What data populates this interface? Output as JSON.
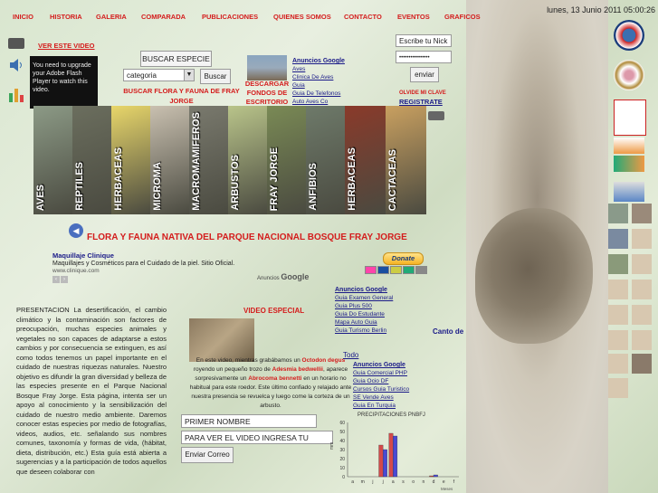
{
  "nav": [
    "INICIO",
    "HISTORIA",
    "GALERIA",
    "COMPARADA",
    "PUBLICACIONES",
    "QUIENES SOMOS",
    "CONTACTO",
    "EVENTOS",
    "GRAFICOS"
  ],
  "date": "lunes, 13 Junio 2011 05:00:26",
  "video_link": "VER ESTE VIDEO",
  "flash_msg": "You need to upgrade your Adobe Flash Player to watch this video.",
  "search": {
    "button_label": "BUSCAR ESPECIE",
    "category_value": "categoria",
    "buscar": "Buscar",
    "link": "BUSCAR FLORA Y FAUNA DE FRAY JORGE"
  },
  "descargar": "DESCARGAR FONDOS DE ESCRITORIO",
  "ads_top": {
    "header": "Anuncios Google",
    "items": [
      "Aves",
      "Clinica De Aves",
      "Guia",
      "Guia De Telefonos",
      "Auto Aves Co"
    ]
  },
  "login": {
    "nick_value": "Escribe tu Nick",
    "password_value": "••••••••••••••••",
    "submit": "enviar",
    "forgot": "OLVIDE MI CLAVE",
    "register": "REGISTRATE"
  },
  "strip_labels": [
    "AVES",
    "REPTILES",
    "HERBACEAS",
    "MICROMA",
    "MACROMAMIFEROS",
    "ARBUSTOS",
    "FRAY JORGE",
    "ANFIBIOS",
    "HERBACEAS",
    "CACTACEAS"
  ],
  "strip_colors": [
    "#8c9a86",
    "#6b6e5e",
    "#e8d66a",
    "#c9c0b0",
    "#7a7a6e",
    "#b9c48a",
    "#7a8a55",
    "#6e7a6a",
    "#8a3a2a",
    "#c9a060"
  ],
  "main_title": "FLORA Y FAUNA NATIVA DEL PARQUE NACIONAL BOSQUE FRAY JORGE",
  "ad_banner": {
    "title": "Maquillaje Clinique",
    "text": "Maquillajes y Cosméticos para el Cuidado de la piel. Sitio Oficial.",
    "url": "www.clinique.com",
    "ads_by": "Anuncios",
    "google": "Google"
  },
  "donate": "Donate",
  "presentacion": "PRESENTACION La desertificación, el cambio climático y la contaminación son factores de preocupación, muchas especies animales y vegetales no son capaces de adaptarse a estos cambios y por consecuencia se extinguen, es así como todos tenemos un papel importante en el cuidado de nuestras riquezas naturales. Nuestro objetivo es difundir la gran diversidad y belleza de las especies presente en el Parque Nacional Bosque Fray Jorge. Esta página, intenta ser un apoyo al conocimiento y la sensibilización del cuidado de nuestro medio ambiente. Daremos conocer estas especies por medio de fotografías, videos, audios, etc. señalando sus nombres comunes, taxonomía y formas de vida, (hábitat, dieta, distribución, etc.) Esta guía está abierta a sugerencias y a la participación de todos aquellos que deseen colaborar con",
  "video_especial": "VIDEO ESPECIAL",
  "video_desc": {
    "p1": "En este video, mientras grabábamos un ",
    "r1": "Octodon degus",
    "p2": " royendo un pequeño trozo de ",
    "r2": "Adesmia bedwellii",
    "p3": ", aparece sorpresivamente un ",
    "r3": "Abrocoma bennetti",
    "p4": " en un horario no habitual para este roedor. Este último confiado y relajado ante nuestra presencia se revuelca y luego come la corteza de un arbusto."
  },
  "form": {
    "name": "PRIMER NOMBRE",
    "video": "PARA VER EL VIDEO INGRESA TU CORR",
    "send": "Enviar Correo"
  },
  "ads_mid": {
    "header": "Anuncios Google",
    "items": [
      "Guia Examen General",
      "Guia Plus 500",
      "Guia Do Estudante",
      "Mapa Auto Guia",
      "Guia Turismo Berlin"
    ]
  },
  "canto": "Canto de",
  "todo": "Todo",
  "ads_bot": {
    "header": "Anuncios Google",
    "items": [
      "Guia Comercial PHP",
      "Guia Ocio DF",
      "Cursos Guia Turistico",
      "SE Vende Aves",
      "Guia En Turquia"
    ]
  },
  "chart_data": {
    "type": "bar",
    "title": "PRECIPITACIONES PNBFJ",
    "ylabel": "mm",
    "categories": [
      "a",
      "m",
      "j",
      "j",
      "a",
      "s",
      "o",
      "n",
      "d",
      "e",
      "f"
    ],
    "series": [
      {
        "name": "",
        "color": "#d44a4a",
        "values": [
          0,
          0,
          0,
          35,
          48,
          0,
          0,
          0,
          1,
          0,
          0
        ]
      },
      {
        "name": "",
        "color": "#4a4ad4",
        "values": [
          0,
          0,
          0,
          30,
          45,
          0,
          0,
          0,
          2,
          0,
          0
        ]
      }
    ],
    "ylim": [
      0,
      60
    ],
    "yticks": [
      0,
      10,
      20,
      30,
      40,
      50,
      60
    ],
    "footer": "Meses"
  }
}
